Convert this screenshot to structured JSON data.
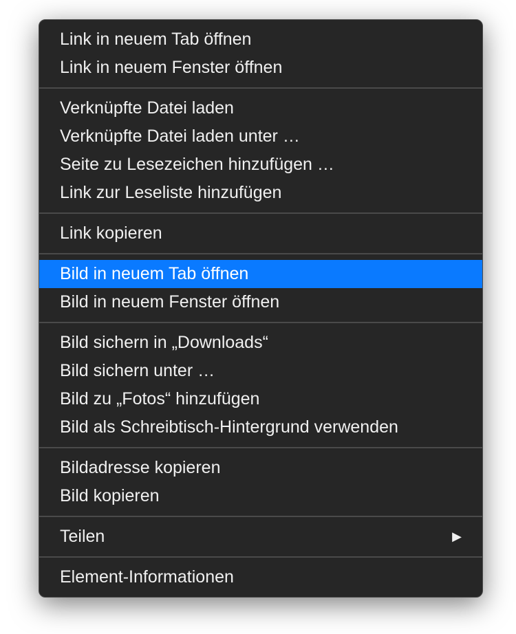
{
  "menu": {
    "groups": [
      [
        {
          "label": "Link in neuem Tab öffnen",
          "name": "open-link-new-tab",
          "highlighted": false,
          "submenu": false
        },
        {
          "label": "Link in neuem Fenster öffnen",
          "name": "open-link-new-window",
          "highlighted": false,
          "submenu": false
        }
      ],
      [
        {
          "label": "Verknüpfte Datei laden",
          "name": "download-linked-file",
          "highlighted": false,
          "submenu": false
        },
        {
          "label": "Verknüpfte Datei laden unter …",
          "name": "download-linked-file-as",
          "highlighted": false,
          "submenu": false
        },
        {
          "label": "Seite zu Lesezeichen hinzufügen …",
          "name": "add-page-to-bookmarks",
          "highlighted": false,
          "submenu": false
        },
        {
          "label": "Link zur Leseliste hinzufügen",
          "name": "add-link-to-reading-list",
          "highlighted": false,
          "submenu": false
        }
      ],
      [
        {
          "label": "Link kopieren",
          "name": "copy-link",
          "highlighted": false,
          "submenu": false
        }
      ],
      [
        {
          "label": "Bild in neuem Tab öffnen",
          "name": "open-image-new-tab",
          "highlighted": true,
          "submenu": false
        },
        {
          "label": "Bild in neuem Fenster öffnen",
          "name": "open-image-new-window",
          "highlighted": false,
          "submenu": false
        }
      ],
      [
        {
          "label": "Bild sichern in „Downloads“",
          "name": "save-image-to-downloads",
          "highlighted": false,
          "submenu": false
        },
        {
          "label": "Bild sichern unter …",
          "name": "save-image-as",
          "highlighted": false,
          "submenu": false
        },
        {
          "label": "Bild zu „Fotos“ hinzufügen",
          "name": "add-image-to-photos",
          "highlighted": false,
          "submenu": false
        },
        {
          "label": "Bild als Schreibtisch-Hintergrund verwenden",
          "name": "use-image-as-desktop",
          "highlighted": false,
          "submenu": false
        }
      ],
      [
        {
          "label": "Bildadresse kopieren",
          "name": "copy-image-address",
          "highlighted": false,
          "submenu": false
        },
        {
          "label": "Bild kopieren",
          "name": "copy-image",
          "highlighted": false,
          "submenu": false
        }
      ],
      [
        {
          "label": "Teilen",
          "name": "share",
          "highlighted": false,
          "submenu": true
        }
      ],
      [
        {
          "label": "Element-Informationen",
          "name": "inspect-element",
          "highlighted": false,
          "submenu": false
        }
      ]
    ]
  }
}
